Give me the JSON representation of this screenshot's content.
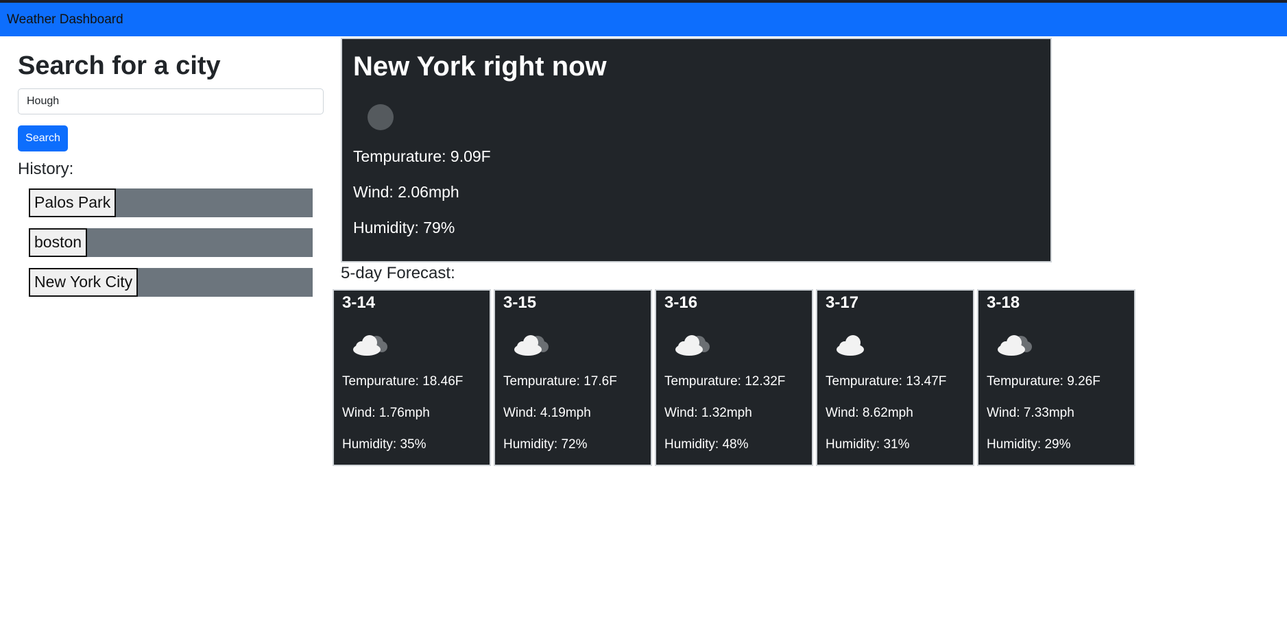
{
  "navbar": {
    "brand": "Weather Dashboard"
  },
  "search": {
    "title": "Search for a city",
    "input_value": "Hough",
    "button_label": "Search"
  },
  "history": {
    "title": "History:",
    "items": [
      "Palos Park",
      "boston",
      "New York City"
    ]
  },
  "current": {
    "title": "New York right now",
    "temperature": "Tempurature: 9.09F",
    "wind": "Wind: 2.06mph",
    "humidity": "Humidity: 79%"
  },
  "forecast": {
    "title": "5-day Forecast:",
    "days": [
      {
        "date": "3-14",
        "icon": "cloud-icon",
        "temperature": "Tempurature: 18.46F",
        "wind": "Wind: 1.76mph",
        "humidity": "Humidity: 35%"
      },
      {
        "date": "3-15",
        "icon": "cloud-icon",
        "temperature": "Tempurature: 17.6F",
        "wind": "Wind: 4.19mph",
        "humidity": "Humidity: 72%"
      },
      {
        "date": "3-16",
        "icon": "cloud-icon",
        "temperature": "Tempurature: 12.32F",
        "wind": "Wind: 1.32mph",
        "humidity": "Humidity: 48%"
      },
      {
        "date": "3-17",
        "icon": "cloud-icon",
        "temperature": "Tempurature: 13.47F",
        "wind": "Wind: 8.62mph",
        "humidity": "Humidity: 31%"
      },
      {
        "date": "3-18",
        "icon": "cloud-icon",
        "temperature": "Tempurature: 9.26F",
        "wind": "Wind: 7.33mph",
        "humidity": "Humidity: 29%"
      }
    ]
  },
  "colors": {
    "navbar": "#0d6efd",
    "card_bg": "#212529",
    "history_bar": "#6c757d",
    "button": "#0d6efd"
  }
}
